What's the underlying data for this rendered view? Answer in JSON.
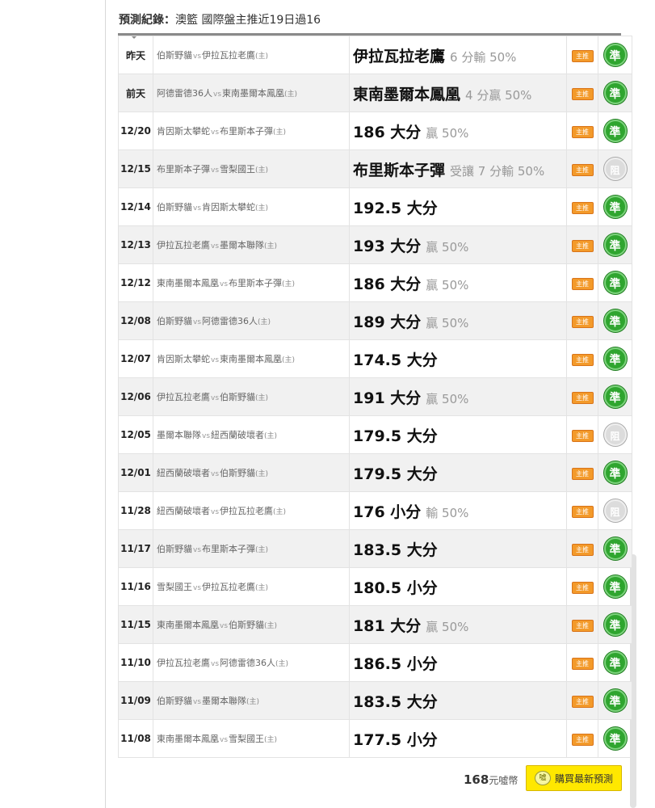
{
  "header": {
    "label": "預測紀錄",
    "colon": "：",
    "text": "澳籃 國際盤主推近19日過16"
  },
  "zhu_label": "主推",
  "home_mark": "(主)",
  "vs": "vs",
  "records": [
    {
      "date": "昨天",
      "away": "伯斯野貓",
      "home": "伊拉瓦拉老鷹",
      "pick": "伊拉瓦拉老鷹",
      "result": "6 分輸 50%",
      "badge": "準",
      "status": "win"
    },
    {
      "date": "前天",
      "away": "阿德雷德36人",
      "home": "東南墨爾本鳳凰",
      "pick": "東南墨爾本鳳凰",
      "result": "4 分贏 50%",
      "badge": "準",
      "status": "win"
    },
    {
      "date": "12/20",
      "away": "肯因斯太攀蛇",
      "home": "布里斯本子彈",
      "pick": "186 大分",
      "result": "贏 50%",
      "badge": "準",
      "status": "win"
    },
    {
      "date": "12/15",
      "away": "布里斯本子彈",
      "home": "雪梨國王",
      "pick": "布里斯本子彈",
      "result": "受讓 7 分輸 50%",
      "badge": "阻",
      "status": "push"
    },
    {
      "date": "12/14",
      "away": "伯斯野貓",
      "home": "肯因斯太攀蛇",
      "pick": "192.5 大分",
      "result": "",
      "badge": "準",
      "status": "win"
    },
    {
      "date": "12/13",
      "away": "伊拉瓦拉老鷹",
      "home": "墨爾本聯隊",
      "pick": "193 大分",
      "result": "贏 50%",
      "badge": "準",
      "status": "win"
    },
    {
      "date": "12/12",
      "away": "東南墨爾本鳳凰",
      "home": "布里斯本子彈",
      "pick": "186 大分",
      "result": "贏 50%",
      "badge": "準",
      "status": "win"
    },
    {
      "date": "12/08",
      "away": "伯斯野貓",
      "home": "阿德雷德36人",
      "pick": "189 大分",
      "result": "贏 50%",
      "badge": "準",
      "status": "win"
    },
    {
      "date": "12/07",
      "away": "肯因斯太攀蛇",
      "home": "東南墨爾本鳳凰",
      "pick": "174.5 大分",
      "result": "",
      "badge": "準",
      "status": "win"
    },
    {
      "date": "12/06",
      "away": "伊拉瓦拉老鷹",
      "home": "伯斯野貓",
      "pick": "191 大分",
      "result": "贏 50%",
      "badge": "準",
      "status": "win"
    },
    {
      "date": "12/05",
      "away": "墨爾本聯隊",
      "home": "紐西蘭破壞者",
      "pick": "179.5 大分",
      "result": "",
      "badge": "阻",
      "status": "push"
    },
    {
      "date": "12/01",
      "away": "紐西蘭破壞者",
      "home": "伯斯野貓",
      "pick": "179.5 大分",
      "result": "",
      "badge": "準",
      "status": "win"
    },
    {
      "date": "11/28",
      "away": "紐西蘭破壞者",
      "home": "伊拉瓦拉老鷹",
      "pick": "176 小分",
      "result": "輸 50%",
      "badge": "阻",
      "status": "push"
    },
    {
      "date": "11/17",
      "away": "伯斯野貓",
      "home": "布里斯本子彈",
      "pick": "183.5 大分",
      "result": "",
      "badge": "準",
      "status": "win"
    },
    {
      "date": "11/16",
      "away": "雪梨國王",
      "home": "伊拉瓦拉老鷹",
      "pick": "180.5 小分",
      "result": "",
      "badge": "準",
      "status": "win"
    },
    {
      "date": "11/15",
      "away": "東南墨爾本鳳凰",
      "home": "伯斯野貓",
      "pick": "181 大分",
      "result": "贏 50%",
      "badge": "準",
      "status": "win"
    },
    {
      "date": "11/10",
      "away": "伊拉瓦拉老鷹",
      "home": "阿德雷德36人",
      "pick": "186.5 小分",
      "result": "",
      "badge": "準",
      "status": "win"
    },
    {
      "date": "11/09",
      "away": "伯斯野貓",
      "home": "墨爾本聯隊",
      "pick": "183.5 大分",
      "result": "",
      "badge": "準",
      "status": "win"
    },
    {
      "date": "11/08",
      "away": "東南墨爾本鳳凰",
      "home": "雪梨國王",
      "pick": "177.5 小分",
      "result": "",
      "badge": "準",
      "status": "win"
    }
  ],
  "footer": {
    "price": "168",
    "unit": "元噓幣",
    "coin": "噓",
    "buy_label": "購買最新預測"
  },
  "colors": {
    "win_badge": "#2fa52f",
    "push_badge": "#dcdcdc",
    "zhu_tag": "#f39a2a",
    "buy_button": "#ffe800"
  }
}
